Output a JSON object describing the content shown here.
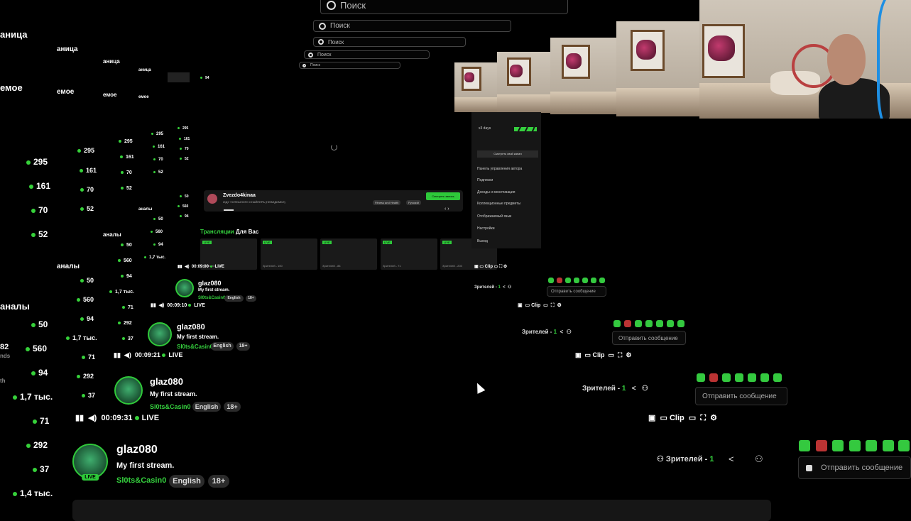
{
  "search": {
    "placeholder": "Поиск"
  },
  "sidebar": {
    "page_label": "аница",
    "recommended_label": "емое",
    "channels_label": "аналы",
    "counts": [
      "295",
      "161",
      "70",
      "52",
      "50",
      "560",
      "94",
      "1,7 тыс.",
      "71",
      "292",
      "37",
      "1,4 тыс."
    ],
    "partial_82": "82",
    "partial_nds": "nds",
    "partial_th": "th"
  },
  "stream": {
    "username": "glaz080",
    "title": "My first stream.",
    "category": "Sl0ts&Casin0",
    "tags": [
      "English",
      "18+"
    ],
    "live_badge": "LIVE",
    "viewers_label": "Зрителей",
    "viewers_count": "1",
    "chat_placeholder": "Отправить сообщение"
  },
  "player": {
    "times": [
      "00:09:31",
      "00:09:21",
      "00:09:10",
      "00:09:00"
    ],
    "live_label": "LIVE",
    "clip_label": "Clip"
  },
  "dashboard": {
    "promo_user": "Zvezdo4kinaa",
    "promo_text": "ЖДУ УСПЕШНОГО СНАЙПЕРА (НЕВИДИМКИ)",
    "promo_tags": [
      "Fitness and Health",
      "Русский"
    ],
    "promo_button": "Смотреть запись",
    "section_title_accent": "Трансляции",
    "section_title": "Для Вас",
    "tiles": [
      {
        "label": "LIVE",
        "viewers": "Зрителей - 101"
      },
      {
        "label": "LIVE",
        "viewers": "Зрителей - 100"
      },
      {
        "label": "LIVE",
        "viewers": "Зрителей - 84"
      },
      {
        "label": "LIVE",
        "viewers": "Зрителей - 71"
      },
      {
        "label": "LIVE",
        "viewers": "Зрителей - 203"
      }
    ],
    "menu_items": [
      "Панель управления автора",
      "Подписки",
      "Доходы и монетизация",
      "Коллекционные предметы",
      "Отображаемый язык",
      "Настройки",
      "Выход"
    ],
    "menu_button": "Смотреть свой канал",
    "menu_days": "x3 days"
  },
  "colors": {
    "accent": "#35d13e",
    "background": "#000000",
    "panel": "#161616"
  }
}
